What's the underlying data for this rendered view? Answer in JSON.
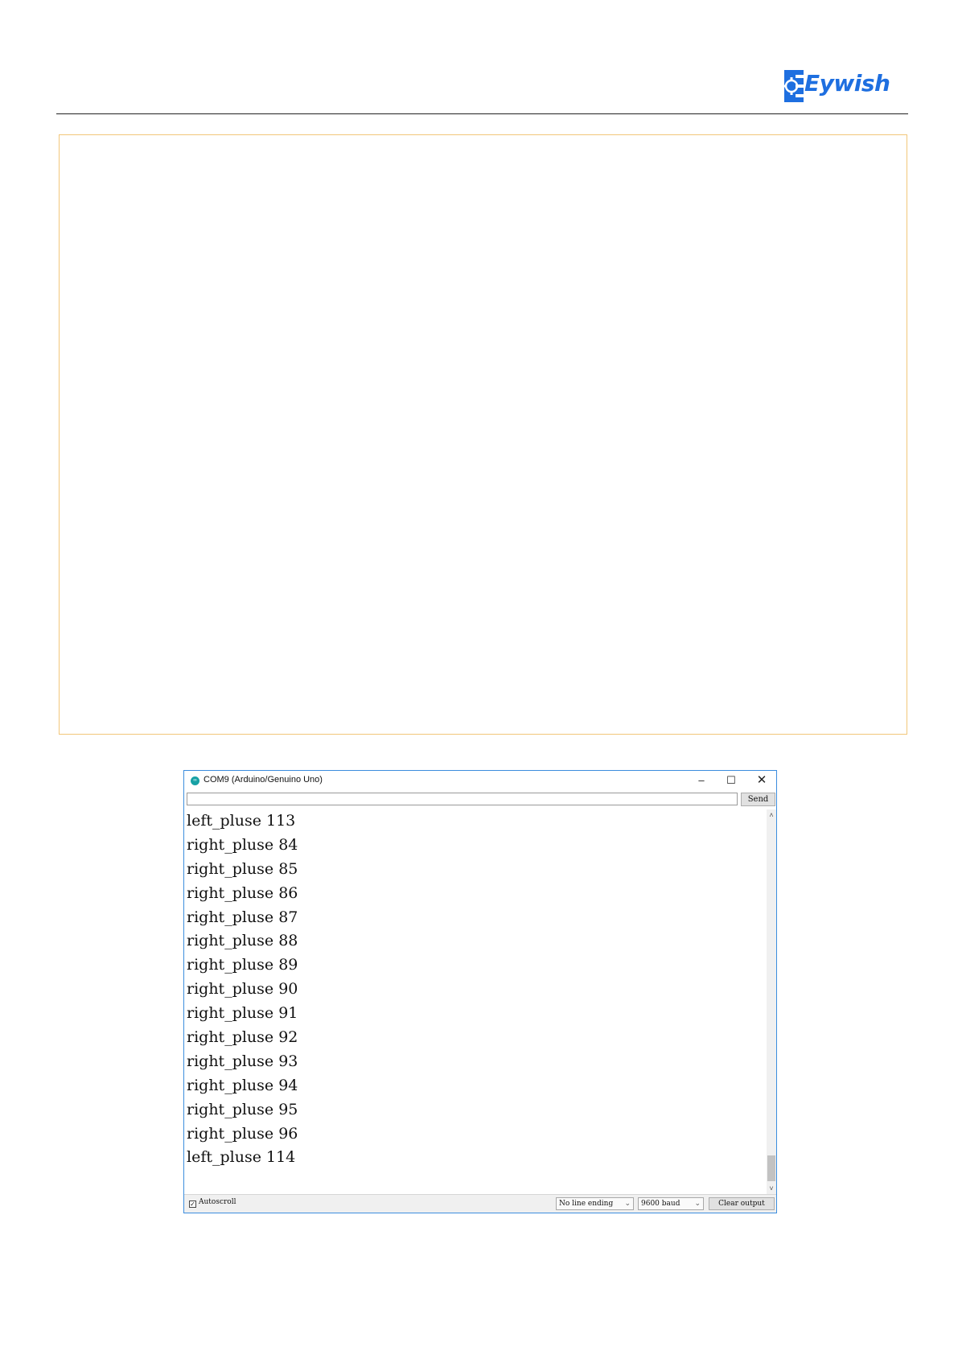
{
  "header": {
    "logo_text": "Eywish"
  },
  "serial_monitor": {
    "title": "COM9 (Arduino/Genuino Uno)",
    "send_label": "Send",
    "input_value": "",
    "output_lines": [
      "left_pluse 113",
      "right_pluse 84",
      "right_pluse 85",
      "right_pluse 86",
      "right_pluse 87",
      "right_pluse 88",
      "right_pluse 89",
      "right_pluse 90",
      "right_pluse 91",
      "right_pluse 92",
      "right_pluse 93",
      "right_pluse 94",
      "right_pluse 95",
      "right_pluse 96",
      "left_pluse 114"
    ],
    "autoscroll_label": "Autoscroll",
    "autoscroll_checked": true,
    "line_ending": "No line ending",
    "baud": "9600 baud",
    "clear_label": "Clear output"
  },
  "colors": {
    "accent": "#1e6fe0",
    "window_border": "#3c8dde",
    "code_box_border": "#f2c77a"
  }
}
